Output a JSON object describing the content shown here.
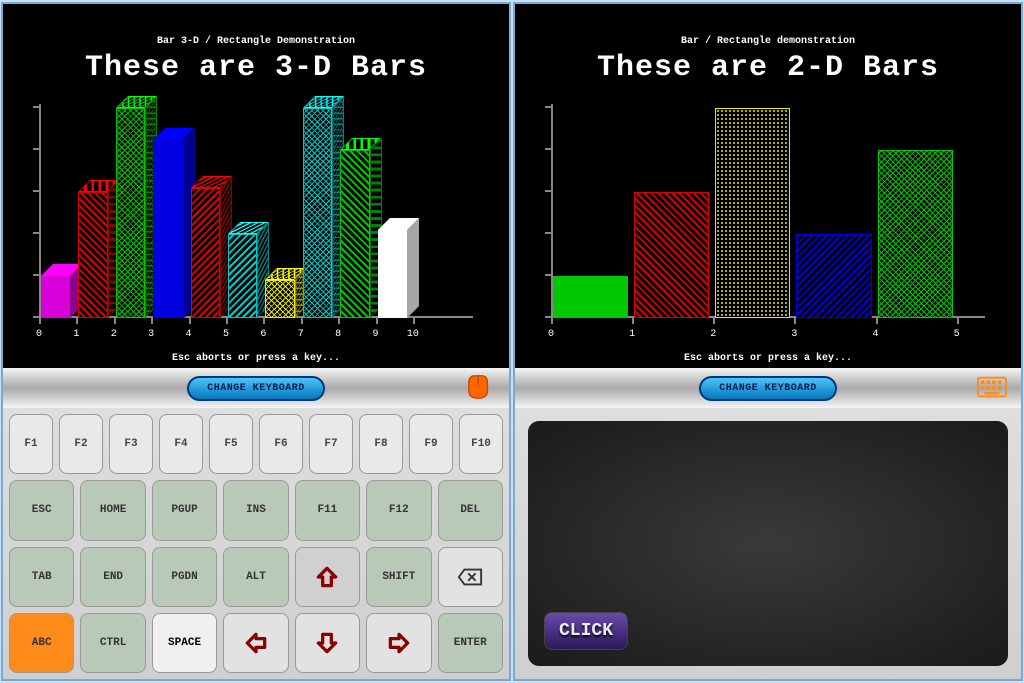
{
  "left": {
    "header": "Bar 3-D / Rectangle Demonstration",
    "title": "These are 3-D Bars",
    "footer": "Esc aborts or press a key...",
    "change_label": "CHANGE KEYBOARD"
  },
  "right": {
    "header": "Bar / Rectangle demonstration",
    "title": "These are 2-D Bars",
    "footer": "Esc aborts or press a key...",
    "change_label": "CHANGE KEYBOARD",
    "click_label": "CLICK"
  },
  "chart_data": [
    {
      "type": "bar",
      "title": "These are 3-D Bars",
      "categories": [
        "0",
        "1",
        "2",
        "3",
        "4",
        "5",
        "6",
        "7",
        "8",
        "9",
        "10"
      ],
      "values": [
        20,
        60,
        100,
        85,
        62,
        40,
        18,
        100,
        80,
        42,
        0
      ],
      "ylim": [
        0,
        100
      ],
      "colors": [
        "#d800d8",
        "#d80000",
        "#00c800",
        "#0000e0",
        "#d80000",
        "#00c8c8",
        "#e8e800",
        "#00c8c8",
        "#00c800",
        "#ffffff"
      ],
      "patterns": [
        "solid",
        "hatch-lr",
        "hatch-x",
        "solid",
        "hatch-rl",
        "hatch-rl",
        "hatch-x",
        "hatch-x",
        "hatch-lr",
        "solid"
      ]
    },
    {
      "type": "bar",
      "title": "These are 2-D Bars",
      "categories": [
        "0",
        "1",
        "2",
        "3",
        "4",
        "5"
      ],
      "values": [
        20,
        60,
        100,
        40,
        80
      ],
      "ylim": [
        0,
        100
      ],
      "colors": [
        "#00c800",
        "#d80000",
        "#e8e800",
        "#0000e0",
        "#00c800"
      ],
      "patterns": [
        "solid",
        "hatch-lr",
        "hatch-dot",
        "hatch-rl",
        "hatch-x"
      ]
    }
  ],
  "keyboard": {
    "rows": [
      [
        "F1",
        "F2",
        "F3",
        "F4",
        "F5",
        "F6",
        "F7",
        "F8",
        "F9",
        "F10"
      ],
      [
        "ESC",
        "HOME",
        "PGUP",
        "INS",
        "F11",
        "F12",
        "DEL"
      ],
      [
        "TAB",
        "END",
        "PGDN",
        "ALT",
        "__UP",
        "SHIFT",
        "__BKSP"
      ],
      [
        "ABC",
        "CTRL",
        "SPACE",
        "__LEFT",
        "__DOWN",
        "__RIGHT",
        "ENTER"
      ]
    ]
  }
}
